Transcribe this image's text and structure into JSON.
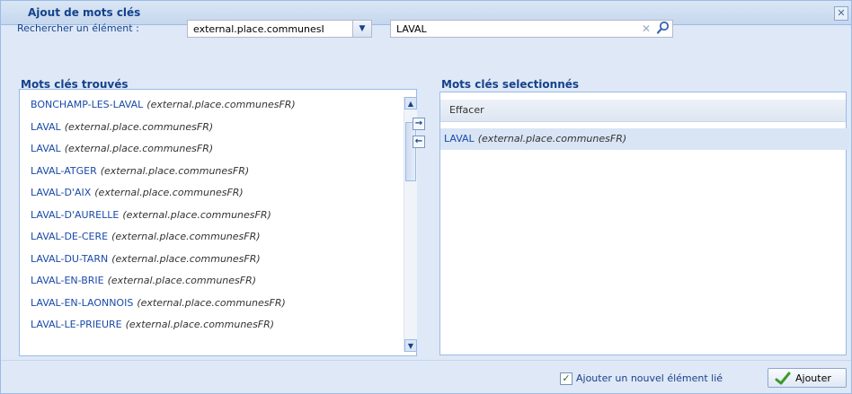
{
  "dialog": {
    "title": "Ajout de mots clés"
  },
  "search": {
    "label": "Rechercher un élément :",
    "combo_value": "external.place.communesI",
    "query": "LAVAL"
  },
  "found": {
    "legend": "Mots clés trouvés",
    "items": [
      {
        "name": "BONCHAMP-LES-LAVAL",
        "type": "(external.place.communesFR)"
      },
      {
        "name": "LAVAL",
        "type": "(external.place.communesFR)"
      },
      {
        "name": "LAVAL",
        "type": "(external.place.communesFR)"
      },
      {
        "name": "LAVAL-ATGER",
        "type": "(external.place.communesFR)"
      },
      {
        "name": "LAVAL-D'AIX",
        "type": "(external.place.communesFR)"
      },
      {
        "name": "LAVAL-D'AURELLE",
        "type": "(external.place.communesFR)"
      },
      {
        "name": "LAVAL-DE-CERE",
        "type": "(external.place.communesFR)"
      },
      {
        "name": "LAVAL-DU-TARN",
        "type": "(external.place.communesFR)"
      },
      {
        "name": "LAVAL-EN-BRIE",
        "type": "(external.place.communesFR)"
      },
      {
        "name": "LAVAL-EN-LAONNOIS",
        "type": "(external.place.communesFR)"
      },
      {
        "name": "LAVAL-LE-PRIEURE",
        "type": "(external.place.communesFR)"
      }
    ]
  },
  "selected": {
    "legend": "Mots clés selectionnés",
    "clear_label": "Effacer",
    "items": [
      {
        "name": "LAVAL",
        "type": "(external.place.communesFR)"
      }
    ]
  },
  "footer": {
    "checkbox_label": "Ajouter un nouvel élément lié",
    "add_label": "Ajouter"
  },
  "colors": {
    "accent": "#15428b",
    "panel_bg": "#dfe8f6",
    "border": "#99bbe8"
  }
}
